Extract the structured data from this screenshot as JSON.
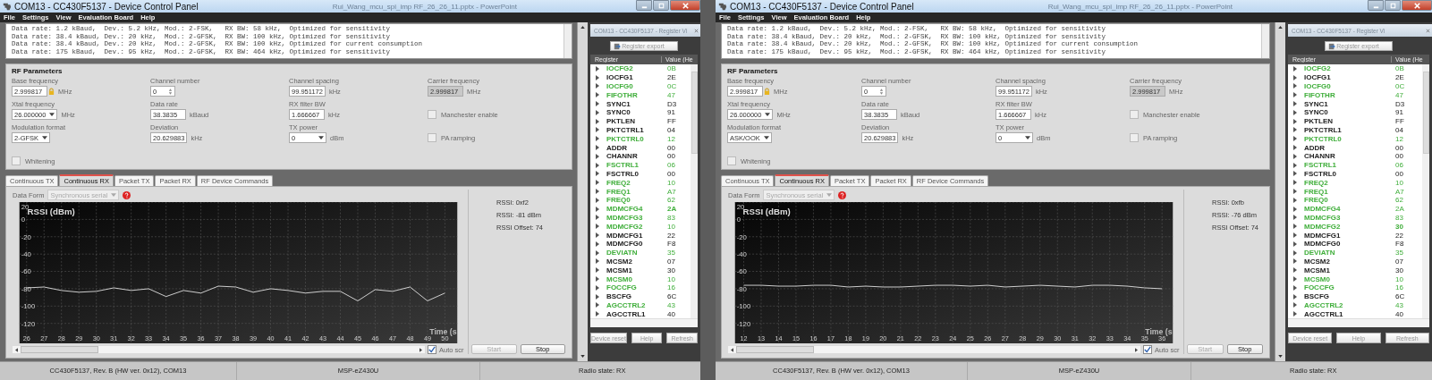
{
  "windows": [
    {
      "title": "COM13 - CC430F5137 - Device Control Panel",
      "background_title": "Rui_Wang_mcu_spi_imp RF_26_26_11.pptx - PowerPoint",
      "menu": [
        "File",
        "Settings",
        "View",
        "Evaluation Board",
        "Help"
      ],
      "presets": [
        "Data rate: 1.2 kBaud,  Dev.: 5.2 kHz, Mod.: 2-FSK,   RX BW: 58 kHz,  Optimized for sensitivity",
        "Data rate: 38.4 kBaud, Dev.: 20 kHz,  Mod.: 2-GFSK,  RX BW: 100 kHz, Optimized for sensitivity",
        "Data rate: 38.4 kBaud, Dev.: 20 kHz,  Mod.: 2-GFSK,  RX BW: 100 kHz, Optimized for current consumption",
        "Data rate: 175 kBaud,  Dev.: 95 kHz,  Mod.: 2-GFSK,  RX BW: 464 kHz, Optimized for sensitivity"
      ],
      "rf_parameters": {
        "heading": "RF Parameters",
        "fields": [
          {
            "kind": "text",
            "label": "Base frequency",
            "value": "2.999817",
            "unit": "MHz",
            "locked": true,
            "disabled": false
          },
          {
            "kind": "spinner",
            "label": "Channel number",
            "value": "0"
          },
          {
            "kind": "text",
            "label": "Channel spacing",
            "value": "99.951172",
            "unit": "kHz",
            "locked": false,
            "disabled": false
          },
          {
            "kind": "text",
            "label": "Carrier frequency",
            "value": "2.999817",
            "unit": "MHz",
            "locked": false,
            "disabled": true
          },
          {
            "kind": "dropdown",
            "label": "Xtal frequency",
            "value": "26.000000",
            "unit": "MHz"
          },
          {
            "kind": "text",
            "label": "Data rate",
            "value": "38.3835",
            "unit": "kBaud",
            "locked": false,
            "disabled": false
          },
          {
            "kind": "text",
            "label": "RX filter BW",
            "value": "1.666667",
            "unit": "kHz",
            "locked": false,
            "disabled": false
          },
          {
            "kind": "checkbox",
            "label": "Manchester enable",
            "checked": false
          },
          {
            "kind": "dropdown",
            "label": "Modulation format",
            "value": "2-GFSK"
          },
          {
            "kind": "text",
            "label": "Deviation",
            "value": "20.629883",
            "unit": "kHz",
            "locked": false,
            "disabled": false
          },
          {
            "kind": "dropdown",
            "label": "TX power",
            "value": "0",
            "unit": "dBm"
          },
          {
            "kind": "checkbox",
            "label": "PA ramping",
            "checked": false
          },
          {
            "kind": "checkbox",
            "label": "Whitening",
            "checked": false
          }
        ]
      },
      "tabs": [
        {
          "label": "Continuous TX",
          "selected": false
        },
        {
          "label": "Continuous RX",
          "selected": true
        },
        {
          "label": "Packet TX",
          "selected": false
        },
        {
          "label": "Packet RX",
          "selected": false
        },
        {
          "label": "RF Device Commands",
          "selected": false
        }
      ],
      "data_format": {
        "label": "Data Form",
        "value": "Synchronous serial"
      },
      "chart_data": {
        "type": "line",
        "grid": true,
        "ylabel": "RSSI (dBm)",
        "xlabel": "Time (s",
        "xlim": [
          25.59,
          50.71
        ],
        "ylim": [
          -143,
          20
        ],
        "xticks": [
          26,
          27,
          28,
          29,
          30,
          31,
          32,
          33,
          34,
          35,
          36,
          37,
          38,
          39,
          40,
          41,
          42,
          43,
          44,
          45,
          46,
          47,
          48,
          49,
          50
        ],
        "yticks": [
          20,
          0,
          -20,
          -40,
          -60,
          -80,
          -100,
          -120
        ],
        "x": [
          26,
          27,
          28,
          29,
          30,
          31,
          32,
          33,
          34,
          35,
          36,
          37,
          38,
          39,
          40,
          41,
          42,
          43,
          44,
          45,
          46,
          47,
          48,
          49,
          50
        ],
        "series": [
          {
            "color": "#e6e6e6",
            "values": [
              -79,
              -78,
              -82,
              -84,
              -83,
              -79,
              -82,
              -80,
              -89,
              -82,
              -85,
              -77,
              -78,
              -84,
              -80,
              -82,
              -85,
              -83,
              -83,
              -94,
              -81,
              -83,
              -78,
              -94,
              -85
            ]
          }
        ]
      },
      "auto_scroll": {
        "label": "Auto scr",
        "checked": true
      },
      "rssi": [
        "RSSI: 0xf2",
        "RSSI: -81 dBm",
        "RSSI Offset: 74"
      ],
      "buttons": [
        {
          "label": "Start",
          "disabled": true
        },
        {
          "label": "Stop",
          "disabled": false
        }
      ],
      "register_view": {
        "title": "COM13 - CC430F5137 - Register Vi",
        "export": "Register export",
        "columns": [
          "Register",
          "Value (He"
        ],
        "rows": [
          {
            "name": "IOCFG2",
            "value": "0B",
            "color": "#3fae3a",
            "selected": false
          },
          {
            "name": "IOCFG1",
            "value": "2E",
            "color": "#222222",
            "selected": false
          },
          {
            "name": "IOCFG0",
            "value": "0C",
            "color": "#3fae3a",
            "selected": false
          },
          {
            "name": "FIFOTHR",
            "value": "47",
            "color": "#3fae3a",
            "selected": false
          },
          {
            "name": "SYNC1",
            "value": "D3",
            "color": "#222222",
            "selected": false
          },
          {
            "name": "SYNC0",
            "value": "91",
            "color": "#222222",
            "selected": false
          },
          {
            "name": "PKTLEN",
            "value": "FF",
            "color": "#222222",
            "selected": false
          },
          {
            "name": "PKTCTRL1",
            "value": "04",
            "color": "#222222",
            "selected": false
          },
          {
            "name": "PKTCTRL0",
            "value": "12",
            "color": "#3fae3a",
            "selected": false
          },
          {
            "name": "ADDR",
            "value": "00",
            "color": "#222222",
            "selected": false
          },
          {
            "name": "CHANNR",
            "value": "00",
            "color": "#222222",
            "selected": false
          },
          {
            "name": "FSCTRL1",
            "value": "06",
            "color": "#3fae3a",
            "selected": false
          },
          {
            "name": "FSCTRL0",
            "value": "00",
            "color": "#222222",
            "selected": false
          },
          {
            "name": "FREQ2",
            "value": "10",
            "color": "#3fae3a",
            "selected": false
          },
          {
            "name": "FREQ1",
            "value": "A7",
            "color": "#3fae3a",
            "selected": false
          },
          {
            "name": "FREQ0",
            "value": "62",
            "color": "#3fae3a",
            "selected": false
          },
          {
            "name": "MDMCFG4",
            "value": "2A",
            "color": "#3fae3a",
            "selected": true
          },
          {
            "name": "MDMCFG3",
            "value": "83",
            "color": "#3fae3a",
            "selected": false
          },
          {
            "name": "MDMCFG2",
            "value": "10",
            "color": "#3fae3a",
            "selected": false
          },
          {
            "name": "MDMCFG1",
            "value": "22",
            "color": "#222222",
            "selected": false
          },
          {
            "name": "MDMCFG0",
            "value": "F8",
            "color": "#222222",
            "selected": false
          },
          {
            "name": "DEVIATN",
            "value": "35",
            "color": "#3fae3a",
            "selected": false
          },
          {
            "name": "MCSM2",
            "value": "07",
            "color": "#222222",
            "selected": false
          },
          {
            "name": "MCSM1",
            "value": "30",
            "color": "#222222",
            "selected": false
          },
          {
            "name": "MCSM0",
            "value": "10",
            "color": "#3fae3a",
            "selected": false
          },
          {
            "name": "FOCCFG",
            "value": "16",
            "color": "#3fae3a",
            "selected": false
          },
          {
            "name": "BSCFG",
            "value": "6C",
            "color": "#222222",
            "selected": false
          },
          {
            "name": "AGCCTRL2",
            "value": "43",
            "color": "#3fae3a",
            "selected": false
          },
          {
            "name": "AGCCTRL1",
            "value": "40",
            "color": "#222222",
            "selected": false
          }
        ],
        "buttons": [
          "Device reset",
          "Help",
          "Refresh"
        ]
      },
      "status": [
        "CC430F5137, Rev. B (HW ver. 0x12), COM13",
        "MSP-eZ430U",
        "Radio state: RX"
      ]
    },
    {
      "title": "COM13 - CC430F5137 - Device Control Panel",
      "background_title": "Rui_Wang_mcu_spi_imp RF_26_26_11.pptx - PowerPoint",
      "menu": [
        "File",
        "Settings",
        "View",
        "Evaluation Board",
        "Help"
      ],
      "presets": [
        "Data rate: 1.2 kBaud,  Dev.: 5.2 kHz, Mod.: 2-FSK,   RX BW: 58 kHz,  Optimized for sensitivity",
        "Data rate: 38.4 kBaud, Dev.: 20 kHz,  Mod.: 2-GFSK,  RX BW: 100 kHz, Optimized for sensitivity",
        "Data rate: 38.4 kBaud, Dev.: 20 kHz,  Mod.: 2-GFSK,  RX BW: 100 kHz, Optimized for current consumption",
        "Data rate: 175 kBaud,  Dev.: 95 kHz,  Mod.: 2-GFSK,  RX BW: 464 kHz, Optimized for sensitivity"
      ],
      "rf_parameters": {
        "heading": "RF Parameters",
        "fields": [
          {
            "kind": "text",
            "label": "Base frequency",
            "value": "2.999817",
            "unit": "MHz",
            "locked": true,
            "disabled": false
          },
          {
            "kind": "spinner",
            "label": "Channel number",
            "value": "0"
          },
          {
            "kind": "text",
            "label": "Channel spacing",
            "value": "99.951172",
            "unit": "kHz",
            "locked": false,
            "disabled": false
          },
          {
            "kind": "text",
            "label": "Carrier frequency",
            "value": "2.999817",
            "unit": "MHz",
            "locked": false,
            "disabled": true
          },
          {
            "kind": "dropdown",
            "label": "Xtal frequency",
            "value": "26.000000",
            "unit": "MHz"
          },
          {
            "kind": "text",
            "label": "Data rate",
            "value": "38.3835",
            "unit": "kBaud",
            "locked": false,
            "disabled": false
          },
          {
            "kind": "text",
            "label": "RX filter BW",
            "value": "1.666667",
            "unit": "kHz",
            "locked": false,
            "disabled": false
          },
          {
            "kind": "checkbox",
            "label": "Manchester enable",
            "checked": false
          },
          {
            "kind": "dropdown",
            "label": "Modulation format",
            "value": "ASK/OOK"
          },
          {
            "kind": "text",
            "label": "Deviation",
            "value": "20.629883",
            "unit": "kHz",
            "locked": false,
            "disabled": false
          },
          {
            "kind": "dropdown",
            "label": "TX power",
            "value": "0",
            "unit": "dBm"
          },
          {
            "kind": "checkbox",
            "label": "PA ramping",
            "checked": false
          },
          {
            "kind": "checkbox",
            "label": "Whitening",
            "checked": false
          }
        ]
      },
      "tabs": [
        {
          "label": "Continuous TX",
          "selected": false
        },
        {
          "label": "Continuous RX",
          "selected": true
        },
        {
          "label": "Packet TX",
          "selected": false
        },
        {
          "label": "Packet RX",
          "selected": false
        },
        {
          "label": "RF Device Commands",
          "selected": false
        }
      ],
      "data_format": {
        "label": "Data Form",
        "value": "Synchronous serial"
      },
      "chart_data": {
        "type": "line",
        "grid": true,
        "ylabel": "RSSI (dBm)",
        "xlabel": "Time (s",
        "xlim": [
          11.5,
          36.62
        ],
        "ylim": [
          -143,
          20
        ],
        "xticks": [
          12,
          13,
          14,
          15,
          16,
          17,
          18,
          19,
          20,
          21,
          22,
          23,
          24,
          25,
          26,
          27,
          28,
          29,
          30,
          31,
          32,
          33,
          34,
          35,
          36
        ],
        "yticks": [
          20,
          0,
          -20,
          -40,
          -60,
          -80,
          -100,
          -120
        ],
        "x": [
          12,
          13,
          14,
          15,
          16,
          17,
          18,
          19,
          20,
          21,
          22,
          23,
          24,
          25,
          26,
          27,
          28,
          29,
          30,
          31,
          32,
          33,
          34,
          35,
          36
        ],
        "series": [
          {
            "color": "#e6e6e6",
            "values": [
              -76,
              -76,
              -77,
              -77,
              -76,
              -76,
              -78,
              -77,
              -78,
              -78,
              -77,
              -76,
              -76,
              -77,
              -76,
              -78,
              -77,
              -76,
              -77,
              -78,
              -76,
              -76,
              -77,
              -79,
              -80
            ]
          }
        ]
      },
      "auto_scroll": {
        "label": "Auto scr",
        "checked": true
      },
      "rssi": [
        "RSSI: 0xfb",
        "RSSI: -76 dBm",
        "RSSI Offset: 74"
      ],
      "buttons": [
        {
          "label": "Start",
          "disabled": true
        },
        {
          "label": "Stop",
          "disabled": false
        }
      ],
      "register_view": {
        "title": "COM13 - CC430F5137 - Register Vi",
        "export": "Register export",
        "columns": [
          "Register",
          "Value (He"
        ],
        "rows": [
          {
            "name": "IOCFG2",
            "value": "0B",
            "color": "#3fae3a",
            "selected": false
          },
          {
            "name": "IOCFG1",
            "value": "2E",
            "color": "#222222",
            "selected": false
          },
          {
            "name": "IOCFG0",
            "value": "0C",
            "color": "#3fae3a",
            "selected": false
          },
          {
            "name": "FIFOTHR",
            "value": "47",
            "color": "#3fae3a",
            "selected": false
          },
          {
            "name": "SYNC1",
            "value": "D3",
            "color": "#222222",
            "selected": false
          },
          {
            "name": "SYNC0",
            "value": "91",
            "color": "#222222",
            "selected": false
          },
          {
            "name": "PKTLEN",
            "value": "FF",
            "color": "#222222",
            "selected": false
          },
          {
            "name": "PKTCTRL1",
            "value": "04",
            "color": "#222222",
            "selected": false
          },
          {
            "name": "PKTCTRL0",
            "value": "12",
            "color": "#3fae3a",
            "selected": false
          },
          {
            "name": "ADDR",
            "value": "00",
            "color": "#222222",
            "selected": false
          },
          {
            "name": "CHANNR",
            "value": "00",
            "color": "#222222",
            "selected": false
          },
          {
            "name": "FSCTRL1",
            "value": "06",
            "color": "#3fae3a",
            "selected": false
          },
          {
            "name": "FSCTRL0",
            "value": "00",
            "color": "#222222",
            "selected": false
          },
          {
            "name": "FREQ2",
            "value": "10",
            "color": "#3fae3a",
            "selected": false
          },
          {
            "name": "FREQ1",
            "value": "A7",
            "color": "#3fae3a",
            "selected": false
          },
          {
            "name": "FREQ0",
            "value": "62",
            "color": "#3fae3a",
            "selected": false
          },
          {
            "name": "MDMCFG4",
            "value": "2A",
            "color": "#3fae3a",
            "selected": false
          },
          {
            "name": "MDMCFG3",
            "value": "83",
            "color": "#3fae3a",
            "selected": false
          },
          {
            "name": "MDMCFG2",
            "value": "30",
            "color": "#3fae3a",
            "selected": true
          },
          {
            "name": "MDMCFG1",
            "value": "22",
            "color": "#222222",
            "selected": false
          },
          {
            "name": "MDMCFG0",
            "value": "F8",
            "color": "#222222",
            "selected": false
          },
          {
            "name": "DEVIATN",
            "value": "35",
            "color": "#3fae3a",
            "selected": false
          },
          {
            "name": "MCSM2",
            "value": "07",
            "color": "#222222",
            "selected": false
          },
          {
            "name": "MCSM1",
            "value": "30",
            "color": "#222222",
            "selected": false
          },
          {
            "name": "MCSM0",
            "value": "10",
            "color": "#3fae3a",
            "selected": false
          },
          {
            "name": "FOCCFG",
            "value": "16",
            "color": "#3fae3a",
            "selected": false
          },
          {
            "name": "BSCFG",
            "value": "6C",
            "color": "#222222",
            "selected": false
          },
          {
            "name": "AGCCTRL2",
            "value": "43",
            "color": "#3fae3a",
            "selected": false
          },
          {
            "name": "AGCCTRL1",
            "value": "40",
            "color": "#222222",
            "selected": false
          }
        ],
        "buttons": [
          "Device reset",
          "Help",
          "Refresh"
        ]
      },
      "status": [
        "CC430F5137, Rev. B (HW ver. 0x12), COM13",
        "MSP-eZ430U",
        "Radio state: RX"
      ]
    }
  ]
}
